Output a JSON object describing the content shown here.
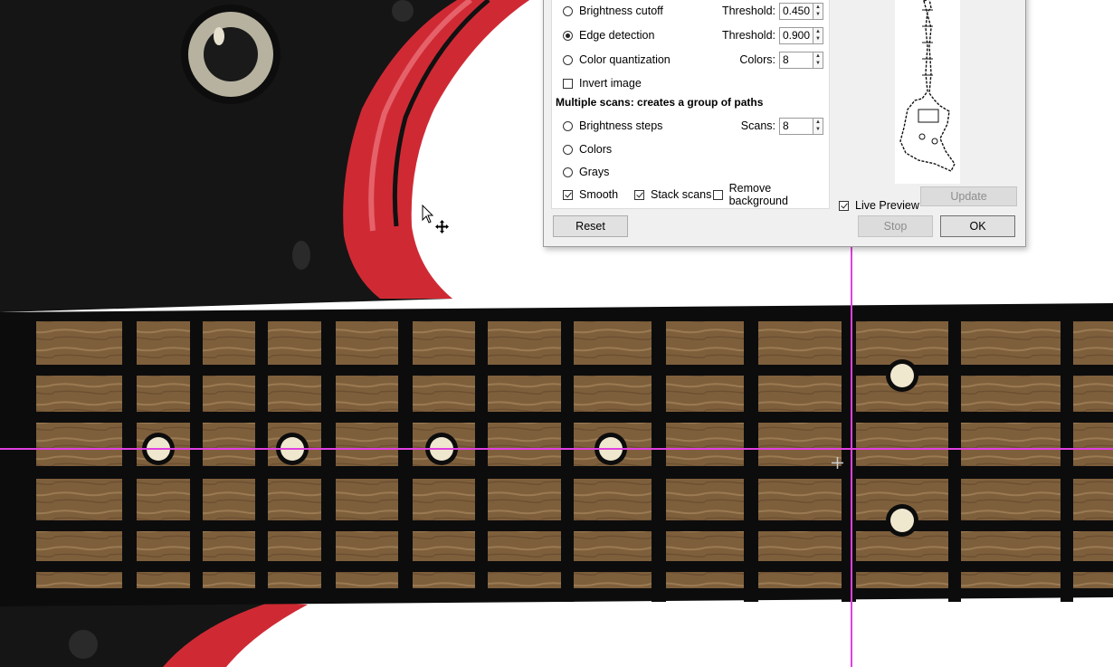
{
  "dialog": {
    "single_scan": {
      "brightness_cutoff": {
        "label": "Brightness cutoff",
        "param_label": "Threshold:",
        "value": "0.450",
        "selected": false
      },
      "edge_detection": {
        "label": "Edge detection",
        "param_label": "Threshold:",
        "value": "0.900",
        "selected": true
      },
      "color_quantization": {
        "label": "Color quantization",
        "param_label": "Colors:",
        "value": "8",
        "selected": false
      },
      "invert_image": {
        "label": "Invert image",
        "checked": false
      }
    },
    "multiple_scans": {
      "heading": "Multiple scans: creates a group of paths",
      "brightness_steps": {
        "label": "Brightness steps",
        "param_label": "Scans:",
        "value": "8",
        "selected": false
      },
      "colors": {
        "label": "Colors",
        "selected": false
      },
      "grays": {
        "label": "Grays",
        "selected": false
      },
      "smooth": {
        "label": "Smooth",
        "checked": true
      },
      "stack_scans": {
        "label": "Stack scans",
        "checked": true
      },
      "remove_background": {
        "label": "Remove background",
        "checked": false
      }
    },
    "preview": {
      "live_preview_label": "Live Preview",
      "live_preview_checked": true,
      "update_label": "Update"
    },
    "buttons": {
      "reset": "Reset",
      "stop": "Stop",
      "ok": "OK"
    }
  },
  "colors": {
    "guide_line": "#e040e0",
    "guitar_body": "#111111",
    "binding_red": "#d42b34",
    "fretboard_wood": "#8a6840",
    "fret_marker": "#efe8cf"
  },
  "icons": [
    "arrow-cursor-icon",
    "move-cursor-icon",
    "crosshair-cursor-icon"
  ]
}
